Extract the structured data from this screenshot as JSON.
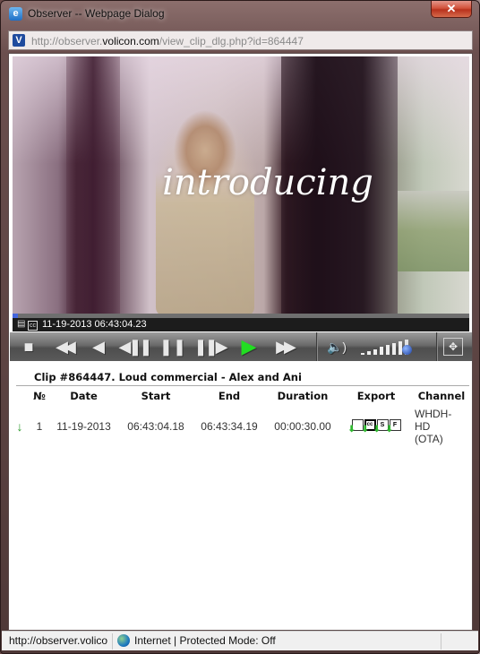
{
  "window": {
    "title": "Observer -- Webpage Dialog",
    "close_label": "✕",
    "app_icon": "ie-icon"
  },
  "address_bar": {
    "site_icon": "volicon-icon",
    "url_prefix": "http://observer.",
    "url_domain": "volicon.com",
    "url_path": "/view_clip_dlg.php?id=864447"
  },
  "video": {
    "overlay_text": "introducing",
    "timestamp": "11-19-2013 06:43:04.23",
    "progress_fraction": 0.01,
    "volume_level_fraction": 0.85,
    "info_icons": [
      "list-icon",
      "closed-caption-icon"
    ]
  },
  "player_controls": [
    {
      "name": "stop-button",
      "glyph": "■"
    },
    {
      "name": "rewind-fast-button",
      "glyph": "◀◀"
    },
    {
      "name": "step-back-button",
      "glyph": "◀"
    },
    {
      "name": "frame-back-button",
      "glyph": "◀❚❚"
    },
    {
      "name": "pause-button",
      "glyph": "❚❚"
    },
    {
      "name": "frame-forward-button",
      "glyph": "❚❚▶"
    },
    {
      "name": "play-button",
      "glyph": "▶"
    },
    {
      "name": "fast-forward-button",
      "glyph": "▶▶"
    }
  ],
  "volume_icon": "🔈)",
  "fullscreen_glyph": "✥",
  "clip": {
    "title": "Clip #864447. Loud commercial - Alex and Ani"
  },
  "table": {
    "headers": [
      "",
      "№",
      "Date",
      "Start",
      "End",
      "Duration",
      "Export",
      "Channel"
    ],
    "rows": [
      {
        "download_glyph": "↓",
        "number": "1",
        "date": "11-19-2013",
        "start": "06:43:04.18",
        "end": "06:43:34.19",
        "duration": "00:00:30.00",
        "export": [
          {
            "name": "export-file-icon",
            "label": ""
          },
          {
            "name": "export-cc-icon",
            "label": "cc"
          },
          {
            "name": "export-s-icon",
            "label": "S"
          },
          {
            "name": "export-f-icon",
            "label": "F"
          }
        ],
        "channel_lines": [
          "WHDH-",
          "HD",
          "(OTA)"
        ]
      }
    ]
  },
  "status_bar": {
    "url": "http://observer.volico",
    "zone": "Internet | Protected Mode: Off"
  }
}
